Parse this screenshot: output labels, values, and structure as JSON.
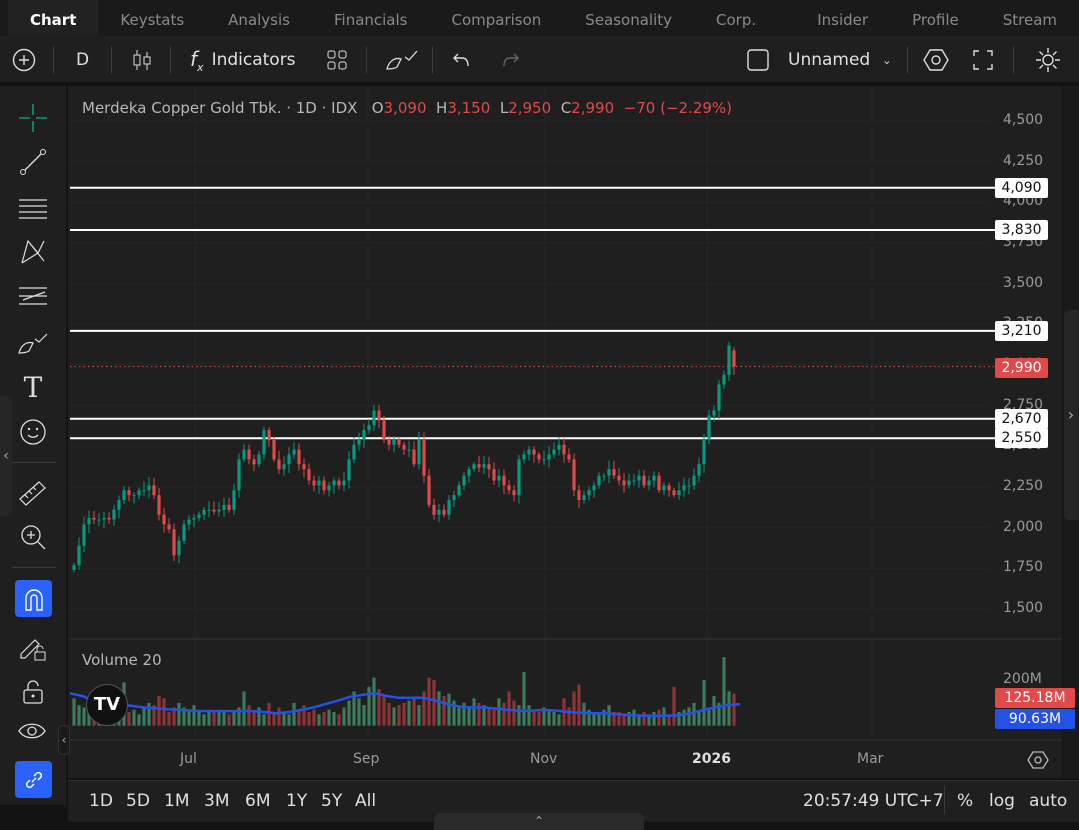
{
  "tabs": [
    "Chart",
    "Keystats",
    "Analysis",
    "Financials",
    "Comparison",
    "Seasonality",
    "Corp. Action",
    "Insider",
    "Profile",
    "Stream"
  ],
  "toolbar": {
    "interval": "D",
    "indicators": "Indicators",
    "layout_name": "Unnamed"
  },
  "legend": {
    "name": "Merdeka Copper Gold Tbk. · 1D · IDX",
    "o_label": "O",
    "o": "3,090",
    "h_label": "H",
    "h": "3,150",
    "l_label": "L",
    "l": "2,950",
    "c_label": "C",
    "c": "2,990",
    "change": "−70 (−2.29%)"
  },
  "price_axis": {
    "ticks": [
      "4,500",
      "4,250",
      "4,000",
      "3,750",
      "3,500",
      "3,250",
      "3,000",
      "2,750",
      "2,500",
      "2,250",
      "2,000",
      "1,750",
      "1,500"
    ],
    "current": "2,990"
  },
  "levels": [
    {
      "value": 4090,
      "label": "4,090"
    },
    {
      "value": 3830,
      "label": "3,830"
    },
    {
      "value": 3210,
      "label": "3,210"
    },
    {
      "value": 2670,
      "label": "2,670"
    },
    {
      "value": 2550,
      "label": "2,550"
    }
  ],
  "volume": {
    "title": "Volume 20",
    "axis_tick": "200M",
    "vol_label": "125.18M",
    "ma_label": "90.63M"
  },
  "time_axis": [
    "Jul",
    "Sep",
    "Nov",
    "2026",
    "Mar"
  ],
  "ranges": [
    "1D",
    "5D",
    "1M",
    "3M",
    "6M",
    "1Y",
    "5Y",
    "All"
  ],
  "clock": "20:57:49 UTC+7",
  "scale_opts": [
    "%",
    "log",
    "auto"
  ],
  "colors": {
    "up": "#089981",
    "down": "#e04a4a",
    "ma": "#2451e6",
    "bg": "#1f1f1f"
  },
  "chart_data": {
    "type": "candlestick",
    "closes": [
      1770,
      1890,
      2020,
      2060,
      2050,
      2050,
      2060,
      2050,
      2110,
      2170,
      2230,
      2200,
      2200,
      2230,
      2230,
      2260,
      2200,
      2080,
      2020,
      1990,
      1830,
      1920,
      2020,
      2050,
      2060,
      2080,
      2110,
      2110,
      2100,
      2110,
      2140,
      2110,
      2230,
      2420,
      2480,
      2420,
      2390,
      2450,
      2600,
      2540,
      2420,
      2360,
      2390,
      2450,
      2480,
      2390,
      2360,
      2290,
      2260,
      2290,
      2230,
      2260,
      2290,
      2260,
      2290,
      2420,
      2510,
      2540,
      2600,
      2630,
      2720,
      2660,
      2540,
      2510,
      2540,
      2510,
      2480,
      2480,
      2390,
      2540,
      2320,
      2140,
      2080,
      2110,
      2080,
      2170,
      2200,
      2260,
      2320,
      2360,
      2390,
      2370,
      2390,
      2360,
      2290,
      2320,
      2260,
      2230,
      2200,
      2420,
      2450,
      2480,
      2450,
      2420,
      2420,
      2450,
      2480,
      2510,
      2450,
      2420,
      2230,
      2170,
      2200,
      2230,
      2260,
      2320,
      2320,
      2360,
      2320,
      2290,
      2260,
      2290,
      2290,
      2320,
      2260,
      2290,
      2320,
      2230,
      2260,
      2230,
      2200,
      2230,
      2260,
      2260,
      2320,
      2390,
      2540,
      2690,
      2720,
      2880,
      2940,
      3120,
      2990
    ],
    "volumes_m": [
      120,
      90,
      80,
      70,
      60,
      100,
      70,
      60,
      80,
      110,
      190,
      60,
      70,
      50,
      80,
      100,
      90,
      130,
      120,
      60,
      80,
      100,
      80,
      70,
      90,
      60,
      50,
      70,
      60,
      70,
      60,
      50,
      60,
      80,
      150,
      90,
      60,
      80,
      50,
      100,
      60,
      80,
      60,
      50,
      100,
      70,
      90,
      60,
      70,
      50,
      60,
      70,
      60,
      50,
      80,
      110,
      150,
      120,
      90,
      170,
      210,
      160,
      130,
      100,
      80,
      90,
      100,
      110,
      120,
      90,
      150,
      210,
      200,
      150,
      130,
      140,
      110,
      90,
      100,
      80,
      120,
      100,
      90,
      80,
      70,
      120,
      100,
      150,
      110,
      90,
      235,
      90,
      70,
      60,
      80,
      70,
      60,
      50,
      120,
      80,
      150,
      180,
      100,
      70,
      60,
      50,
      70,
      90,
      60,
      60,
      50,
      60,
      70,
      50,
      60,
      50,
      60,
      70,
      80,
      50,
      170,
      60,
      70,
      80,
      100,
      60,
      200,
      70,
      130,
      100,
      300,
      150,
      140
    ],
    "volume_ma_m": [
      142,
      130,
      110,
      95,
      91,
      88,
      80,
      77,
      72,
      69,
      66,
      64,
      64,
      64,
      64,
      64,
      60,
      54,
      60,
      69,
      80,
      95,
      110,
      127,
      135,
      142,
      130,
      122,
      122,
      122,
      110,
      95,
      83,
      80,
      80,
      75,
      70,
      64,
      66,
      69,
      65,
      60,
      57,
      55,
      54,
      50,
      46,
      44,
      43,
      44,
      46,
      55,
      69,
      80,
      91,
      94
    ],
    "ylim": [
      1500,
      4500
    ],
    "volume_ylim": [
      0,
      200
    ]
  }
}
